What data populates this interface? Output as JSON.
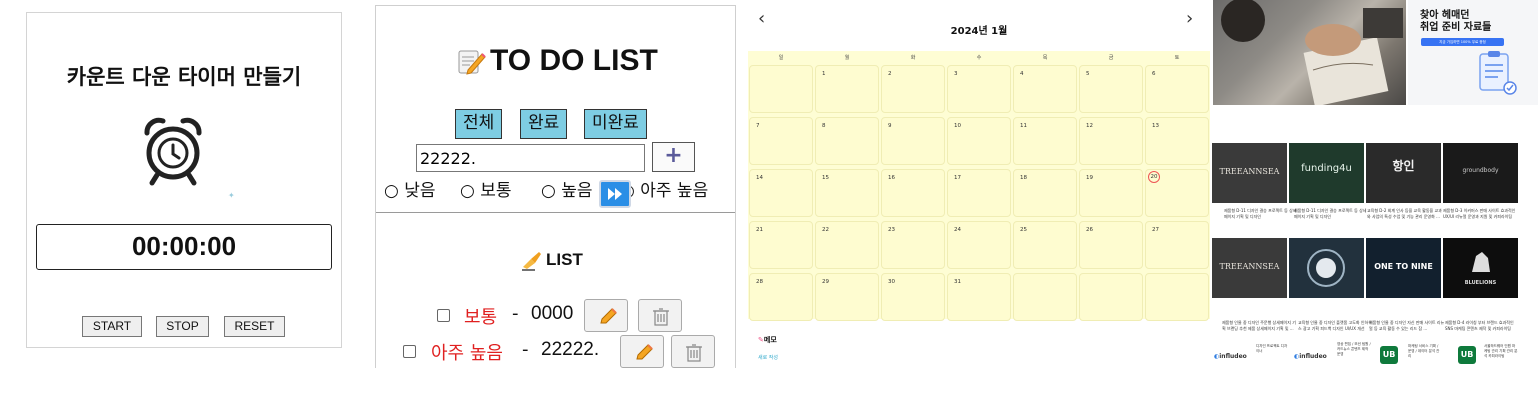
{
  "timer": {
    "title": "카운트 다운 타이머 만들기",
    "display": "00:00:00",
    "buttons": {
      "start": "START",
      "stop": "STOP",
      "reset": "RESET"
    }
  },
  "todo": {
    "title": "TO DO LIST",
    "filters": [
      "전체",
      "완료",
      "미완료"
    ],
    "input_value": "22222.",
    "add_label": "+",
    "priorities": [
      "낮음",
      "보통",
      "높음",
      "아주 높음"
    ],
    "list_title": "LIST",
    "items": [
      {
        "priority": "보통",
        "separator": " - ",
        "text": "0000",
        "priority_color": "#e02020"
      },
      {
        "priority": "아주 높음",
        "separator": " - ",
        "text": "22222.",
        "priority_color": "#e02020"
      }
    ]
  },
  "calendar": {
    "title": "2024년 1월",
    "prev": "‹",
    "next": "›",
    "weekdays": [
      "일",
      "월",
      "화",
      "수",
      "목",
      "금",
      "토"
    ],
    "weeks": [
      [
        "",
        "1",
        "2",
        "3",
        "4",
        "5",
        "6"
      ],
      [
        "7",
        "8",
        "9",
        "10",
        "11",
        "12",
        "13"
      ],
      [
        "14",
        "15",
        "16",
        "17",
        "18",
        "19",
        "20"
      ],
      [
        "21",
        "22",
        "23",
        "24",
        "25",
        "26",
        "27"
      ],
      [
        "28",
        "29",
        "30",
        "31",
        "",
        "",
        ""
      ]
    ],
    "today": "20",
    "memo_title": "메모",
    "memo_add": "새로 작성"
  },
  "ads": {
    "hero": {
      "line1": "찾아 헤매던",
      "line2": "취업 준비 자료들",
      "pill": "지금 가입하면 100% 무료 증정"
    },
    "row1": [
      {
        "label": "TREEANNSEA",
        "caption": "제품형 D-11 디자인 결승 프로젝트 등 상세 페이지 기획 및 디자인"
      },
      {
        "label": "funding4u",
        "caption": "제품형 D-11 디자인 결승 프로젝트 등 상세 페이지 기획 및 디자인"
      },
      {
        "label": "항인",
        "caption": "교육형 D-2 회계 인사 등을 교육 활동을 교과와 사업의 특성 수업 및 기능 관리 운영화 ..."
      },
      {
        "label": "groundbody",
        "caption": "제품형 D-3 이커머스 판매 사이트 효과적인 UX/UI 리뉴얼 운영과 지원 및 카피라이팅"
      }
    ],
    "row2": [
      {
        "label": "TREEANNSEA",
        "caption": "제품형 인물 중 디자인 주문행 상세페이지 기획 브랜딩 추천 제품 상세페이지 기획 및 ..."
      },
      {
        "label": "",
        "caption": "교육형 인물 중 디자인 플랫폼 고도화 인하우스 광고 기획 피드백 디자인 UI/UX 개선"
      },
      {
        "label": "ONE TO NINE",
        "caption": "제품형 인물 중 디자인 자신 판매 사이트 리뉴얼 등 교육 활동 수 있는 리드 참 ..."
      },
      {
        "label": "BLUELIONS",
        "caption": "제품형 D-4 라이칭 부터 브랜드 효과적인 SNS 마케팅 콘텐츠 제작 및 카피라이팅"
      }
    ],
    "brands": [
      {
        "name": "infludeo",
        "caption": "디자인 프로젝트 디자이너"
      },
      {
        "name": "infludeo",
        "caption": "영상 편집 / 모션 팀원 / 카드뉴스 콘텐츠 제작 운영"
      },
      {
        "name": "UB",
        "caption": "마케팅 서비스 기획 / 운영 / 데이터 분석 관리"
      },
      {
        "name": "UB",
        "caption": "서울하드웨어 인원 마케팅 관리 기획 관리 분석 카피라이팅"
      }
    ]
  }
}
